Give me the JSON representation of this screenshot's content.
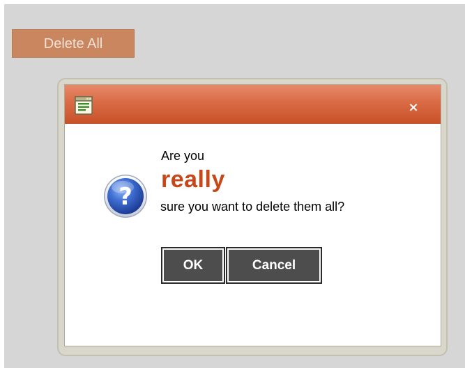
{
  "toolbar": {
    "delete_all_label": "Delete All"
  },
  "dialog": {
    "title_icon": "window-document-icon",
    "close_label": "×",
    "message_icon": "question-icon",
    "message_line1": "Are you",
    "message_emphasis": "really",
    "message_line2": "sure you want to delete them all?",
    "ok_label": "OK",
    "cancel_label": "Cancel"
  },
  "colors": {
    "page_background": "#d6d6d6",
    "delete_button": "#c9865f",
    "titlebar_top": "#e7896a",
    "titlebar_bottom": "#c85127",
    "emphasis_text": "#c64719",
    "dialog_button": "#4d4d4d"
  }
}
